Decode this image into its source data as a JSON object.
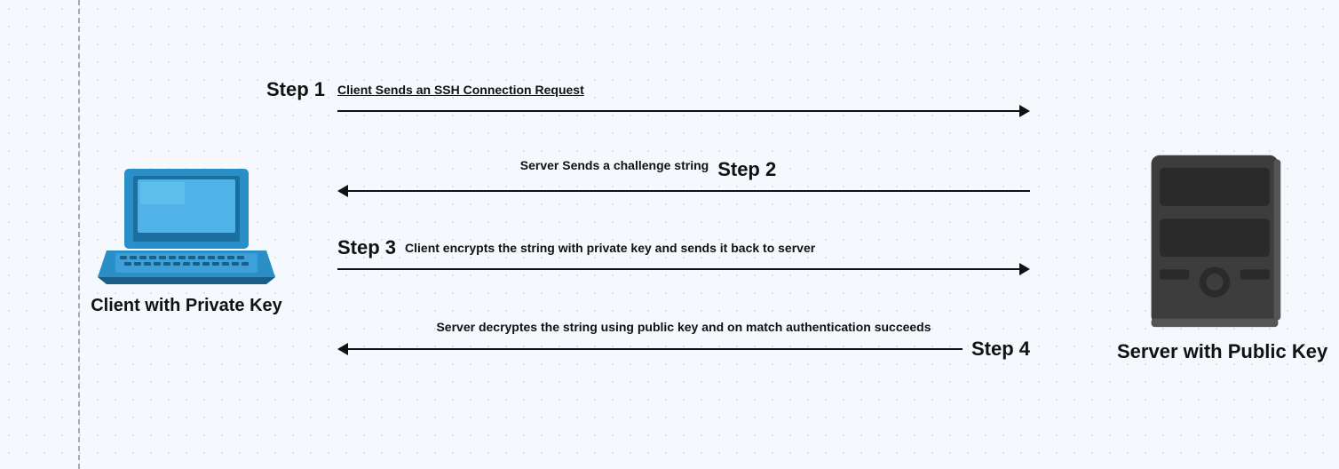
{
  "background": "#f5f8fc",
  "client": {
    "label": "Client with Private Key"
  },
  "server": {
    "label": "Server with Public Key"
  },
  "steps": {
    "step1": {
      "label": "Step 1",
      "text": "Client Sends an SSH Connection Request",
      "direction": "right"
    },
    "step2": {
      "label": "Step 2",
      "text": "Server Sends a challenge string",
      "direction": "left"
    },
    "step3": {
      "label": "Step 3",
      "text": "Client encrypts the string with private key and sends it back to server",
      "direction": "right"
    },
    "step4": {
      "label": "Step 4",
      "text": "Server decryptes the string using public key and on match authentication succeeds",
      "direction": "left"
    }
  }
}
